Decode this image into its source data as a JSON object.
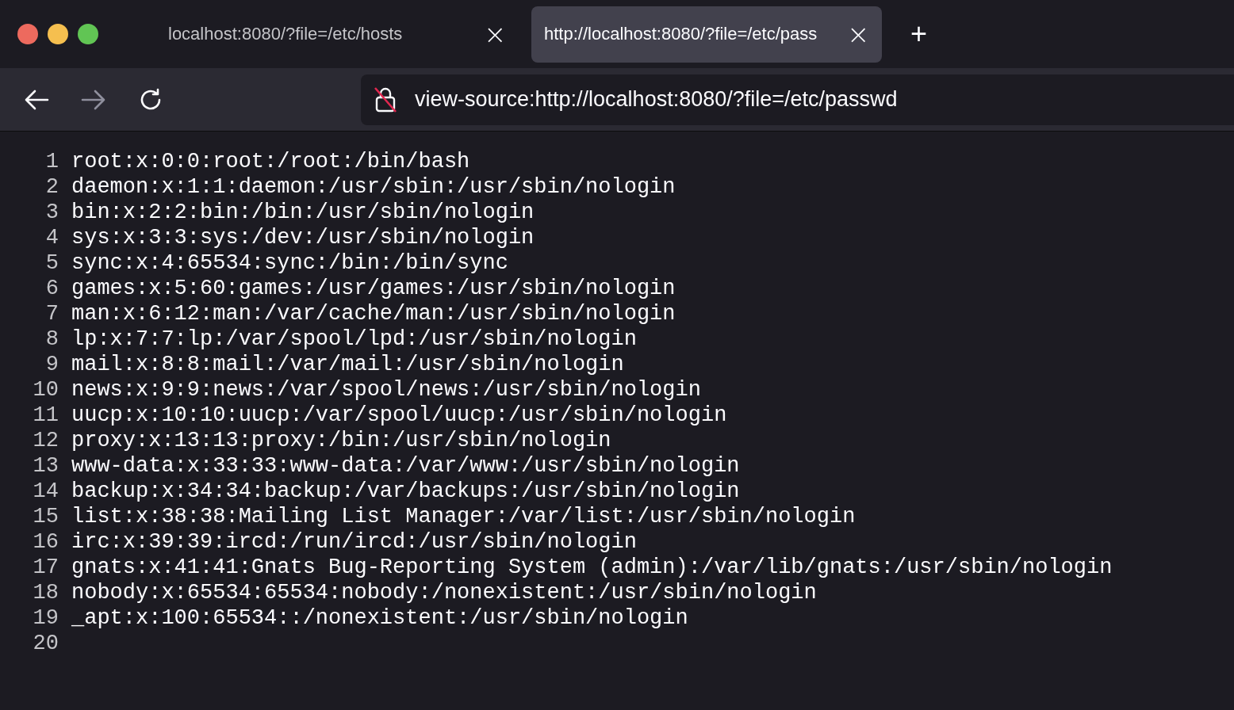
{
  "tabs": [
    {
      "title": "localhost:8080/?file=/etc/hosts",
      "close": "×",
      "selected": false
    },
    {
      "title": "http://localhost:8080/?file=/etc/pass",
      "close": "×",
      "selected": true
    }
  ],
  "new_tab": "+",
  "address_bar": {
    "value": "view-source:http://localhost:8080/?file=/etc/passwd"
  },
  "navigation": {
    "back_disabled": false,
    "forward_disabled": true
  },
  "source_lines": [
    {
      "number": "1",
      "text": "root:x:0:0:root:/root:/bin/bash"
    },
    {
      "number": "2",
      "text": "daemon:x:1:1:daemon:/usr/sbin:/usr/sbin/nologin"
    },
    {
      "number": "3",
      "text": "bin:x:2:2:bin:/bin:/usr/sbin/nologin"
    },
    {
      "number": "4",
      "text": "sys:x:3:3:sys:/dev:/usr/sbin/nologin"
    },
    {
      "number": "5",
      "text": "sync:x:4:65534:sync:/bin:/bin/sync"
    },
    {
      "number": "6",
      "text": "games:x:5:60:games:/usr/games:/usr/sbin/nologin"
    },
    {
      "number": "7",
      "text": "man:x:6:12:man:/var/cache/man:/usr/sbin/nologin"
    },
    {
      "number": "8",
      "text": "lp:x:7:7:lp:/var/spool/lpd:/usr/sbin/nologin"
    },
    {
      "number": "9",
      "text": "mail:x:8:8:mail:/var/mail:/usr/sbin/nologin"
    },
    {
      "number": "10",
      "text": "news:x:9:9:news:/var/spool/news:/usr/sbin/nologin"
    },
    {
      "number": "11",
      "text": "uucp:x:10:10:uucp:/var/spool/uucp:/usr/sbin/nologin"
    },
    {
      "number": "12",
      "text": "proxy:x:13:13:proxy:/bin:/usr/sbin/nologin"
    },
    {
      "number": "13",
      "text": "www-data:x:33:33:www-data:/var/www:/usr/sbin/nologin"
    },
    {
      "number": "14",
      "text": "backup:x:34:34:backup:/var/backups:/usr/sbin/nologin"
    },
    {
      "number": "15",
      "text": "list:x:38:38:Mailing List Manager:/var/list:/usr/sbin/nologin"
    },
    {
      "number": "16",
      "text": "irc:x:39:39:ircd:/run/ircd:/usr/sbin/nologin"
    },
    {
      "number": "17",
      "text": "gnats:x:41:41:Gnats Bug-Reporting System (admin):/var/lib/gnats:/usr/sbin/nologin"
    },
    {
      "number": "18",
      "text": "nobody:x:65534:65534:nobody:/nonexistent:/usr/sbin/nologin"
    },
    {
      "number": "19",
      "text": "_apt:x:100:65534::/nonexistent:/usr/sbin/nologin"
    },
    {
      "number": "20"
    }
  ]
}
